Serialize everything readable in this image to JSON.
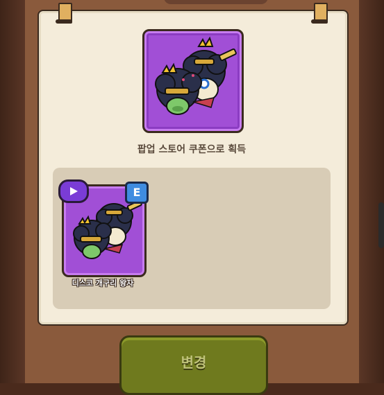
{
  "header": {
    "title": ""
  },
  "featured": {
    "source_label": "팝업 스토어 쿠폰으로 획득"
  },
  "inventory": {
    "items": [
      {
        "name": "디스코 개구리 왕자",
        "badge": "E",
        "has_play": true
      }
    ]
  },
  "actions": {
    "change_label": "변경"
  },
  "colors": {
    "card_purple": "#a14fd6",
    "paper": "#f4ecda",
    "button_olive": "#6f7a1e",
    "badge_blue": "#3f8ce0"
  }
}
